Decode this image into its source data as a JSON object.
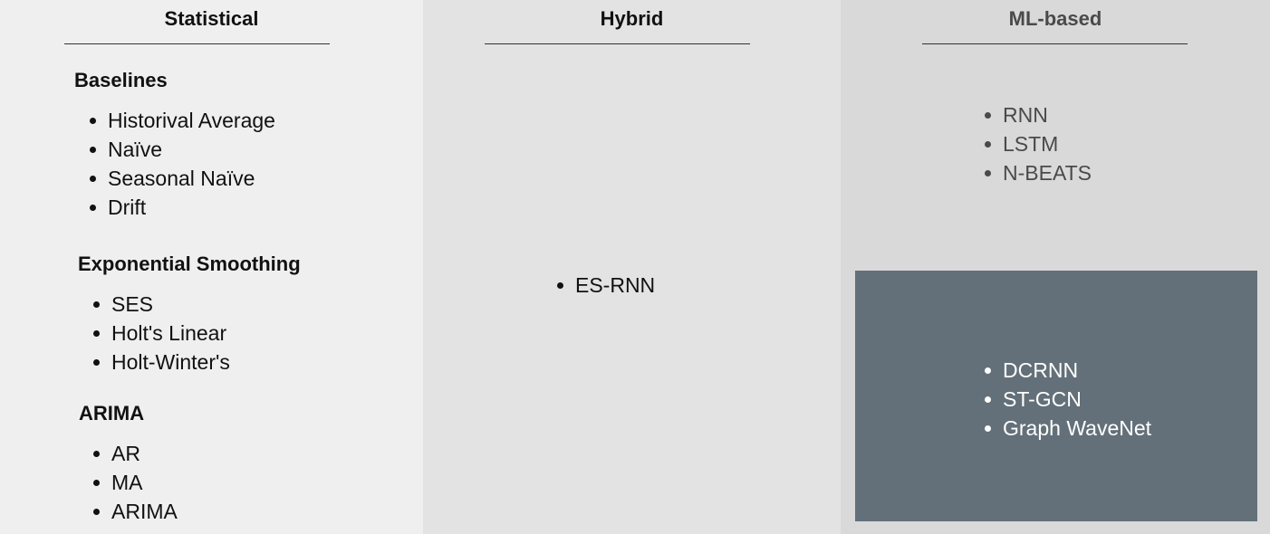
{
  "columns": {
    "statistical": {
      "title": "Statistical",
      "groups": [
        {
          "title": "Baselines",
          "items": [
            "Historival Average",
            "Naïve",
            "Seasonal Naïve",
            "Drift"
          ]
        },
        {
          "title": "Exponential Smoothing",
          "items": [
            "SES",
            "Holt's Linear",
            "Holt-Winter's"
          ]
        },
        {
          "title": "ARIMA",
          "items": [
            "AR",
            "MA",
            "ARIMA"
          ]
        }
      ]
    },
    "hybrid": {
      "title": "Hybrid",
      "items": [
        "ES-RNN"
      ]
    },
    "ml_based": {
      "title": "ML-based",
      "items": [
        "RNN",
        "LSTM",
        "N-BEATS"
      ],
      "graph_items": [
        "DCRNN",
        "ST-GCN",
        "Graph WaveNet"
      ]
    }
  },
  "colors": {
    "statistical_bg": "#efefef",
    "hybrid_bg": "#e3e3e3",
    "ml_bg": "#d9d9d9",
    "graph_box_bg": "#637079",
    "graph_text": "#ffffff"
  }
}
